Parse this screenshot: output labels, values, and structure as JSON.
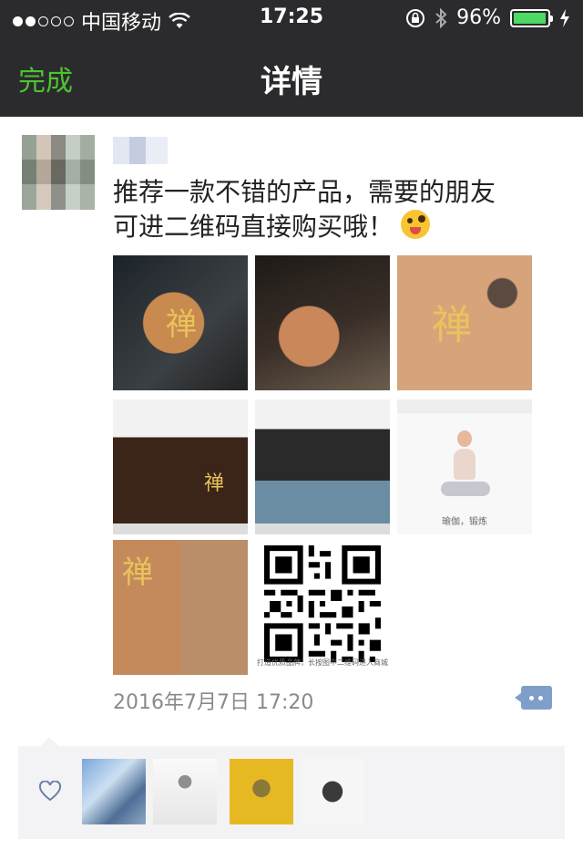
{
  "status_bar": {
    "carrier": "中国移动",
    "time": "17:25",
    "battery_percent": "96%",
    "battery_level": 0.96,
    "icons": [
      "signal-dots-icon",
      "wifi-icon",
      "rotation-lock-icon",
      "bluetooth-icon",
      "battery-icon",
      "charging-icon"
    ]
  },
  "nav": {
    "done_label": "完成",
    "title": "详情"
  },
  "post": {
    "text_line1": "推荐一款不错的产品，需要的朋友",
    "text_line2": "可进二维码直接购买哦！",
    "emoji": "winking-tongue-emoji",
    "images": [
      {
        "name": "cushion-photo-1",
        "mark": "禅"
      },
      {
        "name": "cushion-photo-2",
        "mark": ""
      },
      {
        "name": "cushion-photo-3",
        "mark": "禅"
      },
      {
        "name": "cushion-photo-4",
        "mark": "禅"
      },
      {
        "name": "cushion-photo-5",
        "mark": ""
      },
      {
        "name": "yoga-photo",
        "caption": "瑜伽，锻炼"
      },
      {
        "name": "product-collage",
        "mark": "禅"
      },
      {
        "name": "qr-code",
        "caption": "打造优质品牌，长按图中二维码进入商城"
      }
    ],
    "timestamp": "2016年7月7日 17:20"
  },
  "likes": {
    "icon": "heart-icon",
    "avatars": [
      "liker-avatar-1",
      "liker-avatar-2",
      "liker-avatar-3",
      "liker-avatar-4"
    ]
  },
  "colors": {
    "nav_bg": "#2b2b2d",
    "accent_green": "#4ec231",
    "battery_green": "#4cd964",
    "comment_blue": "#7f9fca"
  }
}
